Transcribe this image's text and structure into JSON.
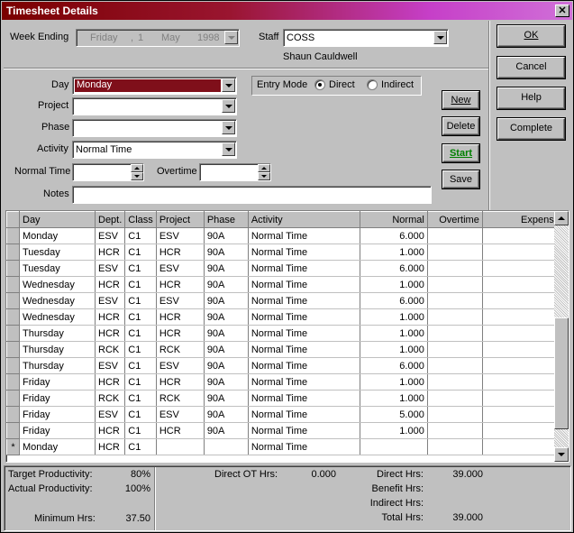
{
  "window": {
    "title": "Timesheet Details",
    "close_label": "✕"
  },
  "header": {
    "week_ending_label": "Week Ending",
    "week_ending": {
      "weekday": "Friday",
      "sep": ",",
      "day": "1",
      "month": "May",
      "year": "1998"
    },
    "staff_label": "Staff",
    "staff_value": "COSS",
    "staff_name": "Shaun Cauldwell"
  },
  "buttons": {
    "ok": "OK",
    "cancel": "Cancel",
    "help": "Help",
    "complete": "Complete",
    "new": "New",
    "delete": "Delete",
    "start": "Start",
    "save": "Save"
  },
  "form": {
    "day_label": "Day",
    "day_value": "Monday",
    "project_label": "Project",
    "project_value": "",
    "phase_label": "Phase",
    "phase_value": "",
    "activity_label": "Activity",
    "activity_value": "Normal Time",
    "normal_time_label": "Normal Time",
    "normal_time_value": "",
    "overtime_label": "Overtime",
    "overtime_value": "",
    "notes_label": "Notes",
    "notes_value": "",
    "entry_mode_label": "Entry Mode",
    "entry_mode_direct": "Direct",
    "entry_mode_indirect": "Indirect",
    "entry_mode_selected": "Direct"
  },
  "grid": {
    "columns": [
      "Day",
      "Dept.",
      "Class",
      "Project",
      "Phase",
      "Activity",
      "Normal",
      "Overtime",
      "Expense"
    ],
    "rows": [
      [
        "Monday",
        "ESV",
        "C1",
        "ESV",
        "90A",
        "Normal Time",
        "6.000",
        "",
        ""
      ],
      [
        "Tuesday",
        "HCR",
        "C1",
        "HCR",
        "90A",
        "Normal Time",
        "1.000",
        "",
        ""
      ],
      [
        "Tuesday",
        "ESV",
        "C1",
        "ESV",
        "90A",
        "Normal Time",
        "6.000",
        "",
        ""
      ],
      [
        "Wednesday",
        "HCR",
        "C1",
        "HCR",
        "90A",
        "Normal Time",
        "1.000",
        "",
        ""
      ],
      [
        "Wednesday",
        "ESV",
        "C1",
        "ESV",
        "90A",
        "Normal Time",
        "6.000",
        "",
        ""
      ],
      [
        "Wednesday",
        "HCR",
        "C1",
        "HCR",
        "90A",
        "Normal Time",
        "1.000",
        "",
        ""
      ],
      [
        "Thursday",
        "HCR",
        "C1",
        "HCR",
        "90A",
        "Normal Time",
        "1.000",
        "",
        ""
      ],
      [
        "Thursday",
        "RCK",
        "C1",
        "RCK",
        "90A",
        "Normal Time",
        "1.000",
        "",
        ""
      ],
      [
        "Thursday",
        "ESV",
        "C1",
        "ESV",
        "90A",
        "Normal Time",
        "6.000",
        "",
        ""
      ],
      [
        "Friday",
        "HCR",
        "C1",
        "HCR",
        "90A",
        "Normal Time",
        "1.000",
        "",
        ""
      ],
      [
        "Friday",
        "RCK",
        "C1",
        "RCK",
        "90A",
        "Normal Time",
        "1.000",
        "",
        ""
      ],
      [
        "Friday",
        "ESV",
        "C1",
        "ESV",
        "90A",
        "Normal Time",
        "5.000",
        "",
        ""
      ],
      [
        "Friday",
        "HCR",
        "C1",
        "HCR",
        "90A",
        "Normal Time",
        "1.000",
        "",
        ""
      ]
    ],
    "new_row_marker": "*",
    "new_row": [
      "Monday",
      "HCR",
      "C1",
      "",
      "",
      "Normal Time",
      "",
      "",
      ""
    ]
  },
  "summary": {
    "target_productivity_label": "Target Productivity:",
    "target_productivity": "80%",
    "actual_productivity_label": "Actual Productivity:",
    "actual_productivity": "100%",
    "minimum_hrs_label": "Minimum Hrs:",
    "minimum_hrs": "37.50",
    "direct_ot_label": "Direct OT Hrs:",
    "direct_ot": "0.000",
    "direct_hrs_label": "Direct Hrs:",
    "direct_hrs": "39.000",
    "benefit_hrs_label": "Benefit Hrs:",
    "benefit_hrs": "",
    "indirect_hrs_label": "Indirect Hrs:",
    "indirect_hrs": "",
    "total_hrs_label": "Total Hrs:",
    "total_hrs": "39.000"
  },
  "colors": {
    "title_start": "#7a0000",
    "title_end": "#d070d8",
    "selected_combo": "#7f0f1a",
    "start_green": "#008000"
  }
}
